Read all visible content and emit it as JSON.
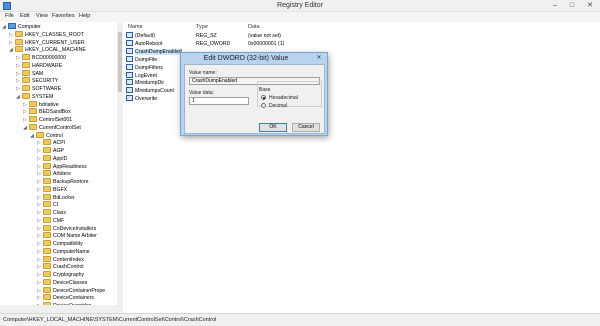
{
  "window": {
    "title": "Registry Editor",
    "minimize": "–",
    "maximize": "□",
    "close": "✕"
  },
  "menu": [
    "File",
    "Edit",
    "View",
    "Favorites",
    "Help"
  ],
  "tree": [
    {
      "label": "Computer",
      "indent": 0,
      "exp": "◢",
      "icon": "pc"
    },
    {
      "label": "HKEY_CLASSES_ROOT",
      "indent": 1,
      "exp": "▷",
      "icon": "folder"
    },
    {
      "label": "HKEY_CURRENT_USER",
      "indent": 1,
      "exp": "▷",
      "icon": "folder"
    },
    {
      "label": "HKEY_LOCAL_MACHINE",
      "indent": 1,
      "exp": "◢",
      "icon": "folder"
    },
    {
      "label": "BCD00000000",
      "indent": 2,
      "exp": "▷",
      "icon": "folder"
    },
    {
      "label": "HARDWARE",
      "indent": 2,
      "exp": "▷",
      "icon": "folder"
    },
    {
      "label": "SAM",
      "indent": 2,
      "exp": "▷",
      "icon": "folder"
    },
    {
      "label": "SECURITY",
      "indent": 2,
      "exp": "▷",
      "icon": "folder"
    },
    {
      "label": "SOFTWARE",
      "indent": 2,
      "exp": "▷",
      "icon": "folder"
    },
    {
      "label": "SYSTEM",
      "indent": 2,
      "exp": "◢",
      "icon": "folder"
    },
    {
      "label": "bdriative",
      "indent": 3,
      "exp": "▷",
      "icon": "folder"
    },
    {
      "label": "BEDSandBox",
      "indent": 3,
      "exp": "▷",
      "icon": "folder"
    },
    {
      "label": "ControlSet001",
      "indent": 3,
      "exp": "▷",
      "icon": "folder"
    },
    {
      "label": "CurrentControlSet",
      "indent": 3,
      "exp": "◢",
      "icon": "folder"
    },
    {
      "label": "Control",
      "indent": 4,
      "exp": "◢",
      "icon": "folder"
    },
    {
      "label": "ACPI",
      "indent": 5,
      "exp": "▷",
      "icon": "folder"
    },
    {
      "label": "AGP",
      "indent": 5,
      "exp": "▷",
      "icon": "folder"
    },
    {
      "label": "AppID",
      "indent": 5,
      "exp": "▷",
      "icon": "folder"
    },
    {
      "label": "AppReadiness",
      "indent": 5,
      "exp": "▷",
      "icon": "folder"
    },
    {
      "label": "Arbiters",
      "indent": 5,
      "exp": "▷",
      "icon": "folder"
    },
    {
      "label": "BackupRestore",
      "indent": 5,
      "exp": "▷",
      "icon": "folder"
    },
    {
      "label": "BGFX",
      "indent": 5,
      "exp": "▷",
      "icon": "folder"
    },
    {
      "label": "BitLocker",
      "indent": 5,
      "exp": "▷",
      "icon": "folder"
    },
    {
      "label": "CI",
      "indent": 5,
      "exp": "▷",
      "icon": "folder"
    },
    {
      "label": "Class",
      "indent": 5,
      "exp": "▷",
      "icon": "folder"
    },
    {
      "label": "CMF",
      "indent": 5,
      "exp": "▷",
      "icon": "folder"
    },
    {
      "label": "CoDeviceInstallers",
      "indent": 5,
      "exp": "▷",
      "icon": "folder"
    },
    {
      "label": "COM Name Arbiter",
      "indent": 5,
      "exp": "▷",
      "icon": "folder"
    },
    {
      "label": "Compatibility",
      "indent": 5,
      "exp": "▷",
      "icon": "folder"
    },
    {
      "label": "ComputerName",
      "indent": 5,
      "exp": "▷",
      "icon": "folder"
    },
    {
      "label": "ContentIndex",
      "indent": 5,
      "exp": "▷",
      "icon": "folder"
    },
    {
      "label": "CrashControl",
      "indent": 5,
      "exp": "▷",
      "icon": "folder"
    },
    {
      "label": "Cryptography",
      "indent": 5,
      "exp": "▷",
      "icon": "folder"
    },
    {
      "label": "DeviceClasses",
      "indent": 5,
      "exp": "▷",
      "icon": "folder"
    },
    {
      "label": "DeviceContainerPrope",
      "indent": 5,
      "exp": "▷",
      "icon": "folder"
    },
    {
      "label": "DeviceContainers",
      "indent": 5,
      "exp": "▷",
      "icon": "folder"
    },
    {
      "label": "DeviceOverrides",
      "indent": 5,
      "exp": "▷",
      "icon": "folder"
    }
  ],
  "list": {
    "columns": [
      "Name",
      "Type",
      "Data"
    ],
    "rows": [
      {
        "name": "(Default)",
        "type": "REG_SZ",
        "data": "(value not set)",
        "selected": false
      },
      {
        "name": "AutoReboot",
        "type": "REG_DWORD",
        "data": "0x00000001 (1)",
        "selected": false
      },
      {
        "name": "CrashDumpEnabled",
        "type": "",
        "data": "",
        "selected": true
      },
      {
        "name": "DumpFile",
        "type": "",
        "data": "",
        "selected": false
      },
      {
        "name": "DumpFilters",
        "type": "",
        "data": "",
        "selected": false
      },
      {
        "name": "LogEvent",
        "type": "",
        "data": "",
        "selected": false
      },
      {
        "name": "MinidumpDir",
        "type": "",
        "data": "",
        "selected": false
      },
      {
        "name": "MinidumpsCount",
        "type": "",
        "data": "",
        "selected": false
      },
      {
        "name": "Overwrite",
        "type": "",
        "data": "",
        "selected": false
      }
    ]
  },
  "status": "Computer\\HKEY_LOCAL_MACHINE\\SYSTEM\\CurrentControlSet\\Control\\CrashControl",
  "dialog": {
    "title": "Edit DWORD (32-bit) Value",
    "close": "✕",
    "value_name_label": "Value name:",
    "value_name": "CrashDumpEnabled",
    "value_data_label": "Value data:",
    "value_data": "1",
    "base_label": "Base",
    "hex_label": "Hexadecimal",
    "dec_label": "Decimal",
    "ok": "OK",
    "cancel": "Cancel"
  }
}
